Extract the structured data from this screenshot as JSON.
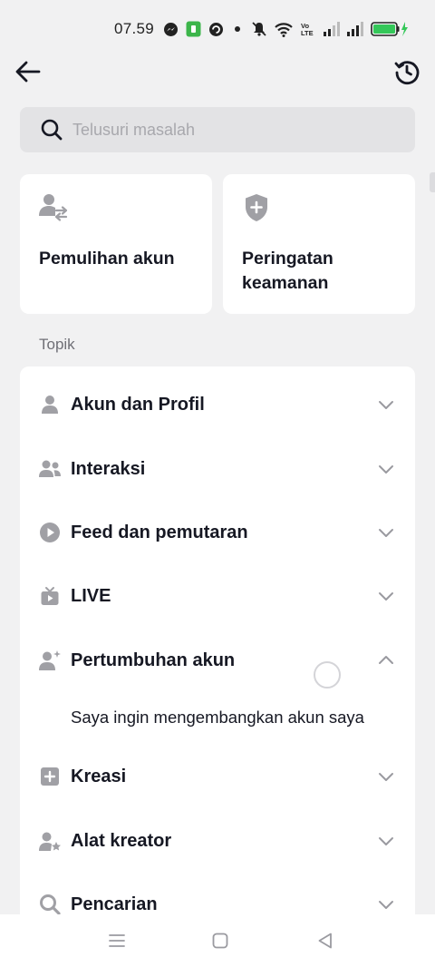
{
  "status_bar": {
    "time": "07.59",
    "icons": [
      "messenger-icon",
      "app-notification-icon",
      "sync-icon",
      "dot-icon",
      "mute-icon",
      "wifi-icon",
      "volte-icon",
      "signal-1-icon",
      "signal-2-icon",
      "battery-charging-icon"
    ],
    "volte_label": "Vo\nLTE"
  },
  "header": {
    "back_icon": "arrow-left-icon",
    "history_icon": "history-icon"
  },
  "search": {
    "placeholder": "Telusuri masalah"
  },
  "quick_cards": [
    {
      "label": "Pemulihan akun",
      "icon": "account-switch-icon"
    },
    {
      "label": "Peringatan keamanan",
      "icon": "shield-plus-icon"
    }
  ],
  "topics_title": "Topik",
  "topics": [
    {
      "label": "Akun dan Profil",
      "icon": "person-icon",
      "expanded": false
    },
    {
      "label": "Interaksi",
      "icon": "people-icon",
      "expanded": false
    },
    {
      "label": "Feed dan pemutaran",
      "icon": "play-icon",
      "expanded": false
    },
    {
      "label": "LIVE",
      "icon": "tv-icon",
      "expanded": false
    },
    {
      "label": "Pertumbuhan akun",
      "icon": "person-sparkle-icon",
      "expanded": true
    },
    {
      "label": "Kreasi",
      "icon": "plus-square-icon",
      "expanded": false
    },
    {
      "label": "Alat kreator",
      "icon": "person-star-icon",
      "expanded": false
    },
    {
      "label": "Pencarian",
      "icon": "search-icon",
      "expanded": false
    }
  ],
  "expanded_sub_item": "Saya ingin mengembangkan akun saya",
  "colors": {
    "background": "#f1f1f2",
    "card": "#ffffff",
    "icon_gray": "#a0a0a5",
    "text": "#161823",
    "muted_text": "#6f6f76",
    "search_bg": "#e3e3e5",
    "battery_green": "#34c759"
  },
  "nav_bar": {
    "buttons": [
      "menu-icon",
      "home-square-icon",
      "back-triangle-icon"
    ]
  }
}
